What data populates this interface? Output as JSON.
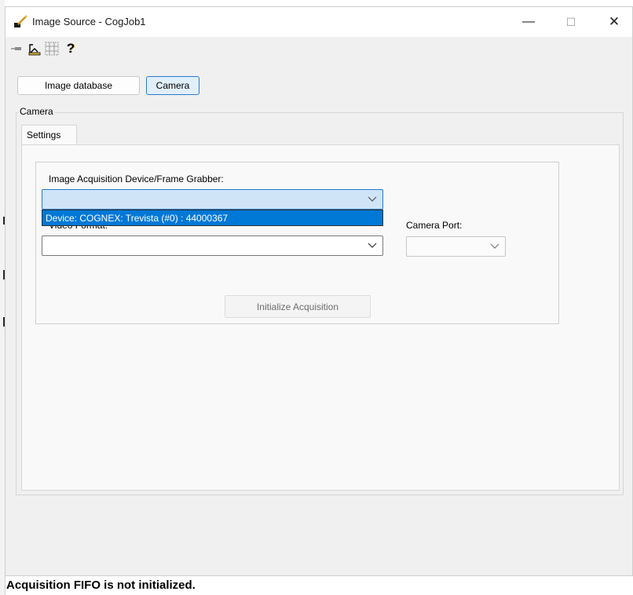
{
  "window": {
    "title": "Image Source - CogJob1",
    "app_icon": "cognex-wand-icon",
    "controls": {
      "minimize": "—",
      "maximize": "☐",
      "close": "✕"
    }
  },
  "toolbar": {
    "icons": [
      "pin-icon",
      "measure-tool-icon",
      "grid-select-icon",
      "help-icon"
    ],
    "help_glyph": "?"
  },
  "source_buttons": {
    "image_database": "Image database",
    "camera": "Camera",
    "selected": "Camera"
  },
  "camera_group": {
    "label": "Camera",
    "tabs": [
      {
        "label": "Settings",
        "selected": true
      }
    ],
    "settings": {
      "device_label": "Image Acquisition Device/Frame Grabber:",
      "device_value": "",
      "device_dropdown_option": "Device: COGNEX: Trevista (#0) : 44000367",
      "video_format_label": "Video Format:",
      "video_format_value": "",
      "camera_port_label": "Camera Port:",
      "camera_port_value": "",
      "initialize_button": "Initialize Acquisition"
    }
  },
  "status": {
    "message": "Acquisition FIFO is not initialized."
  },
  "colors": {
    "selection": "#0078d7",
    "focus_border": "#2a76c6",
    "window_bg": "#f0f0f0"
  }
}
